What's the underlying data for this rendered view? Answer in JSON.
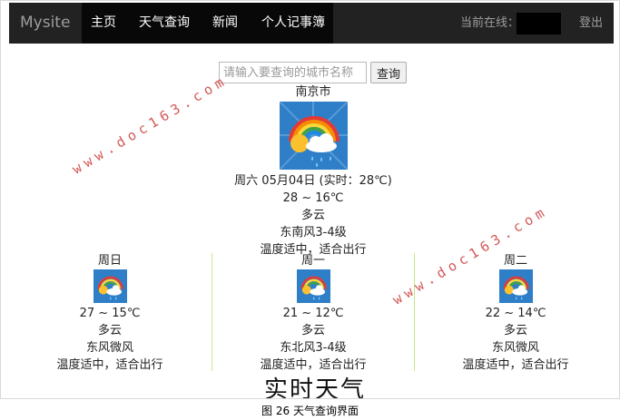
{
  "navbar": {
    "brand": "Mysite",
    "items": [
      "主页",
      "天气查询",
      "新闻",
      "个人记事簿"
    ],
    "online_label": "当前在线：",
    "logout": "登出"
  },
  "search": {
    "placeholder": "请输入要查询的城市名称",
    "button": "查询"
  },
  "today": {
    "city": "南京市",
    "date": "周六 05月04日 (实时：28℃)",
    "temp_range": "28 ~ 16℃",
    "condition": "多云",
    "wind": "东南风3-4级",
    "advice": "温度适中，适合出行",
    "icon": "rainbow-cloud-rain-sun"
  },
  "forecast": [
    {
      "day": "周日",
      "temp_range": "27 ~ 15℃",
      "condition": "多云",
      "wind": "东风微风",
      "advice": "温度适中，适合出行",
      "icon": "rainbow-cloud-rain-sun"
    },
    {
      "day": "周一",
      "temp_range": "21 ~ 12℃",
      "condition": "多云",
      "wind": "东北风3-4级",
      "advice": "温度适中，适合出行",
      "icon": "rainbow-cloud-rain-sun"
    },
    {
      "day": "周二",
      "temp_range": "22 ~ 14℃",
      "condition": "多云",
      "wind": "东风微风",
      "advice": "温度适中，适合出行",
      "icon": "rainbow-cloud-rain-sun"
    }
  ],
  "clipped_heading": "实时天气",
  "caption": "图 26  天气查询界面",
  "watermark": "www.doc163.com",
  "colors": {
    "navbar": "#222222",
    "divider": "#c6e88a",
    "watermark": "#cc3a3a",
    "icon_bg": "#2f7fc8"
  }
}
